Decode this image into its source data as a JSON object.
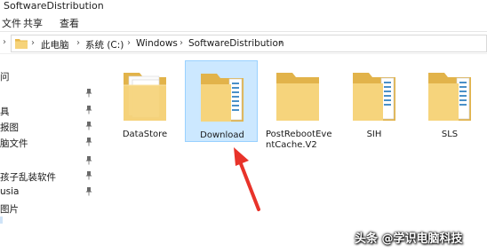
{
  "window": {
    "title": "SoftwareDistribution"
  },
  "ribbon": {
    "tabs": [
      "文件",
      "共享",
      "查看"
    ]
  },
  "address": {
    "breadcrumbs": [
      "此电脑",
      "系统 (C:)",
      "Windows",
      "SoftwareDistribution"
    ]
  },
  "nav_pane": {
    "items": [
      "问",
      "具",
      "报图",
      "脑文件",
      "孩子乱装软件",
      "usia",
      "图片"
    ]
  },
  "folders": [
    {
      "name": "DataStore",
      "selected": false
    },
    {
      "name": "Download",
      "selected": true
    },
    {
      "name": "PostRebootEventCache.V2",
      "selected": false
    },
    {
      "name": "SIH",
      "selected": false
    },
    {
      "name": "SLS",
      "selected": false
    }
  ],
  "folder_labels": {
    "datastore": "DataStore",
    "download": "Download",
    "postreboot_line1": "PostRebootEve",
    "postreboot_line2": "ntCache.V2",
    "sih": "SIH",
    "sls": "SLS"
  },
  "annotation": {
    "arrow_color": "#e8332a"
  },
  "watermark": "头条 @学识电脑科技",
  "colors": {
    "selection_bg": "#cce8ff",
    "selection_border": "#99d1ff",
    "folder": "#f3d27a"
  }
}
